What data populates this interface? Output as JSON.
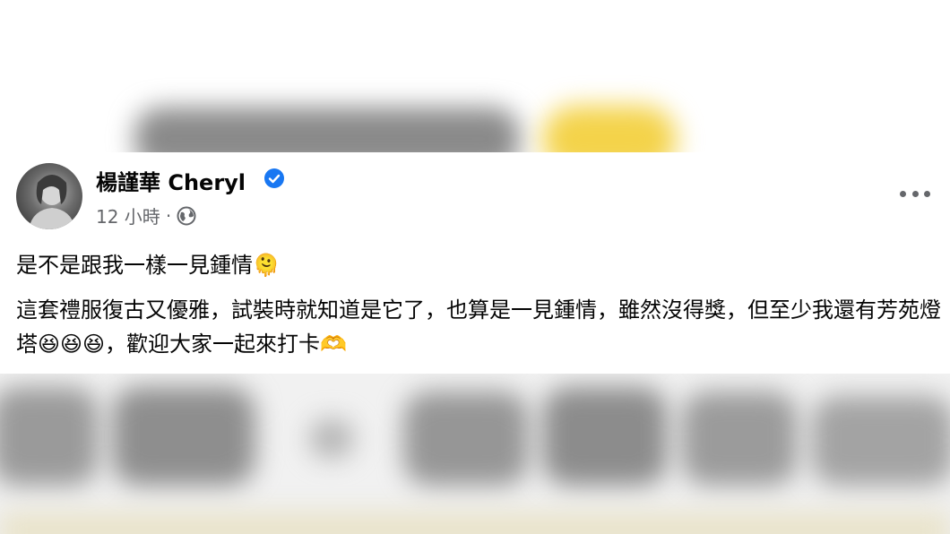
{
  "post": {
    "author": "楊謹華 Cheryl",
    "time": "12 小時",
    "separator": "·",
    "line1": "是不是跟我一樣一見鍾情🫠",
    "body": "這套禮服復古又優雅，試裝時就知道是它了，也算是一見鍾情，雖然沒得獎，但至少我還有芳苑燈塔😆😆😆，歡迎大家一起來打卡🫶"
  },
  "icons": {
    "verified": "verified-badge-icon",
    "audience": "globe-icon",
    "menu": "more-options-icon"
  },
  "colors": {
    "verified": "#1877f2",
    "meta_text": "#65676b",
    "text": "#050505"
  }
}
